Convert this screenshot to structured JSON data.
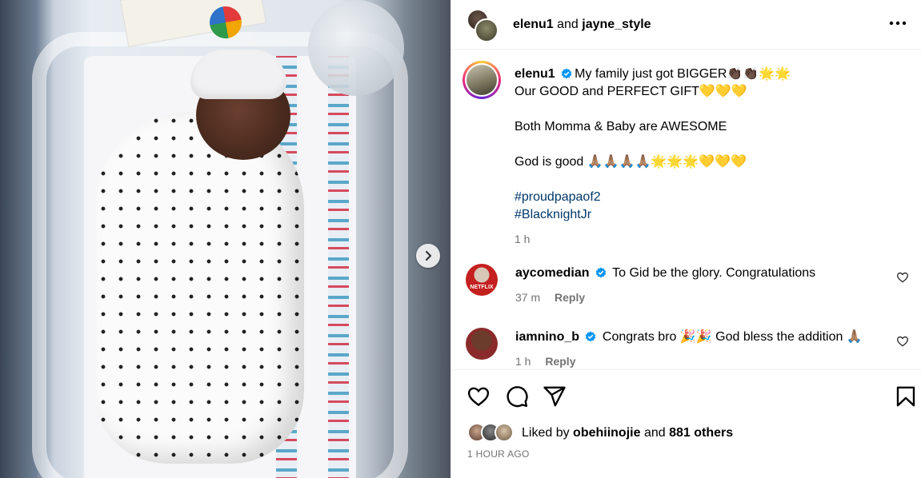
{
  "header": {
    "author_primary": "elenu1",
    "joiner": " and ",
    "author_secondary": "jayne_style",
    "more_icon": "more-horizontal-icon"
  },
  "caption": {
    "username": "elenu1",
    "lines": [
      "My family just got BIGGER👏🏿👏🏿🌟🌟",
      "Our GOOD and PERFECT GIFT💛💛💛",
      "",
      "Both Momma & Baby are AWESOME",
      "",
      "God is good 🙏🏽🙏🏽🙏🏽🙏🏽🌟🌟🌟💛💛💛",
      ""
    ],
    "hashtags": [
      "#proudpapaof2",
      "#BlacknightJr"
    ],
    "time": "1 h"
  },
  "comments": [
    {
      "username": "aycomedian",
      "text": "To Gid be the glory. Congratulations",
      "time": "37 m",
      "reply": "Reply",
      "avatar_label": "NETFLIX",
      "avatar_color": "#c4201f"
    },
    {
      "username": "iamnino_b",
      "text": "Congrats bro 🎉🎉 God bless the addition 🙏🏽",
      "time": "1 h",
      "reply": "Reply",
      "avatar_color": "#8a2a2a"
    }
  ],
  "actions": {
    "icons": [
      "heart-icon",
      "comment-icon",
      "share-icon",
      "bookmark-icon"
    ]
  },
  "likes": {
    "prefix": "Liked by ",
    "user": "obehiinojie",
    "middle": " and ",
    "others": "881 others"
  },
  "posted_ago": "1 HOUR AGO",
  "colors": {
    "verified": "#0095f6",
    "hashtag": "#00376b",
    "muted": "#737373",
    "netflix_red": "#c4201f"
  }
}
